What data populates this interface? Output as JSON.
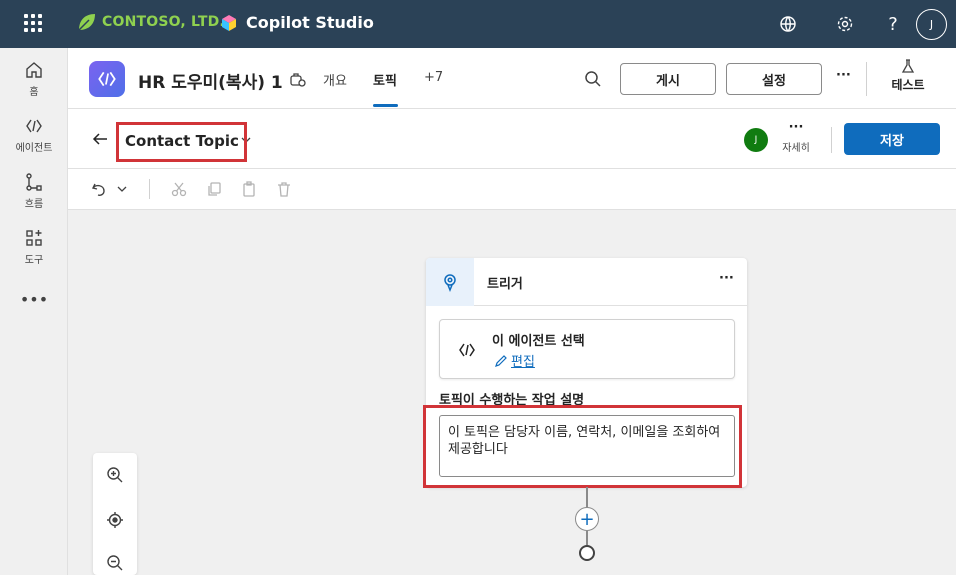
{
  "topbar": {
    "brand": "CONTOSO, LTD.",
    "product": "Copilot Studio",
    "user_initial": "J"
  },
  "rail": [
    {
      "label": "홈",
      "icon": "home-icon"
    },
    {
      "label": "에이전트",
      "icon": "agent-icon"
    },
    {
      "label": "흐름",
      "icon": "flow-icon"
    },
    {
      "label": "도구",
      "icon": "tools-icon"
    }
  ],
  "agent_header": {
    "title": "HR 도우미(복사) 1",
    "tabs": [
      {
        "label": "개요"
      },
      {
        "label": "토픽"
      },
      {
        "label": "+7"
      }
    ],
    "publish": "게시",
    "settings": "설정",
    "more": "···",
    "test": "테스트"
  },
  "topic_header": {
    "name": "Contact Topic",
    "user_initial": "J",
    "details": "자세히",
    "more": "···",
    "save": "저장"
  },
  "node": {
    "title": "트리거",
    "more": "···",
    "agent_select": "이 에이전트 선택",
    "edit": "편집",
    "desc_label": "토픽이 수행하는 작업 설명",
    "desc_value": "이 토픽은 담당자 이름, 연락처, 이메일을 조회하여 제공합니다"
  },
  "colors": {
    "topbar": "#2b4257",
    "accent": "#0f6cbd",
    "highlight": "#d13438"
  }
}
